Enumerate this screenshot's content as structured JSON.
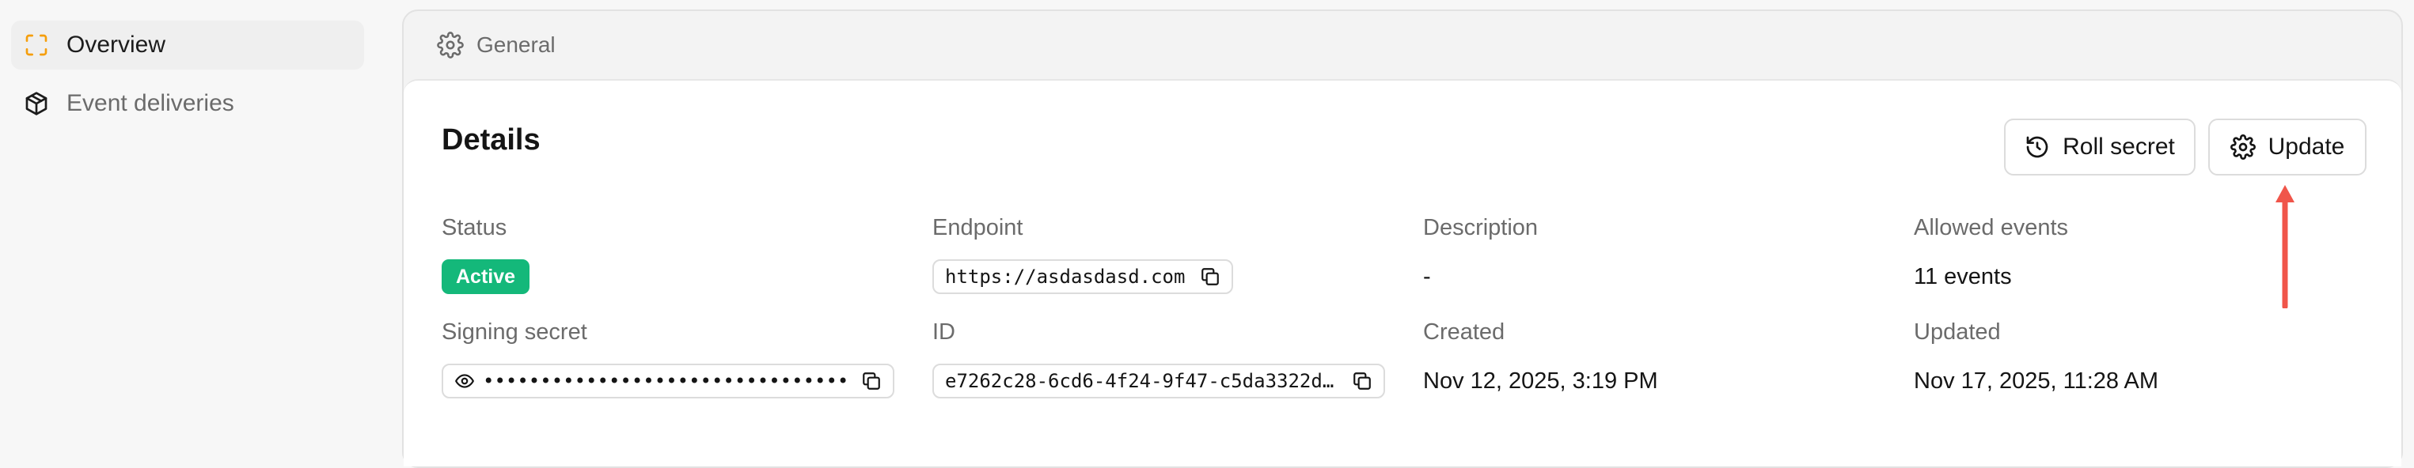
{
  "sidebar": {
    "items": [
      {
        "label": "Overview",
        "icon": "focus-frame-icon",
        "active": true
      },
      {
        "label": "Event deliveries",
        "icon": "package-icon",
        "active": false
      }
    ]
  },
  "panel": {
    "header_label": "General",
    "header_icon": "gear-icon"
  },
  "details": {
    "title": "Details",
    "buttons": {
      "roll_secret": "Roll secret",
      "update": "Update"
    },
    "fields": {
      "status_label": "Status",
      "status_value": "Active",
      "endpoint_label": "Endpoint",
      "endpoint_value": "https://asdasdasd.com",
      "description_label": "Description",
      "description_value": "-",
      "allowed_events_label": "Allowed events",
      "allowed_events_value": "11 events",
      "signing_secret_label": "Signing secret",
      "signing_secret_value": "••••••••••••••••••••••••••••••••",
      "id_label": "ID",
      "id_value": "e7262c28-6cd6-4f24-9f47-c5da3322d…",
      "created_label": "Created",
      "created_value": "Nov 12, 2025, 3:19 PM",
      "updated_label": "Updated",
      "updated_value": "Nov 17, 2025, 11:28 AM"
    }
  },
  "colors": {
    "accent": "#f59e0b",
    "status_active": "#14b87a",
    "arrow": "#f0554a"
  }
}
